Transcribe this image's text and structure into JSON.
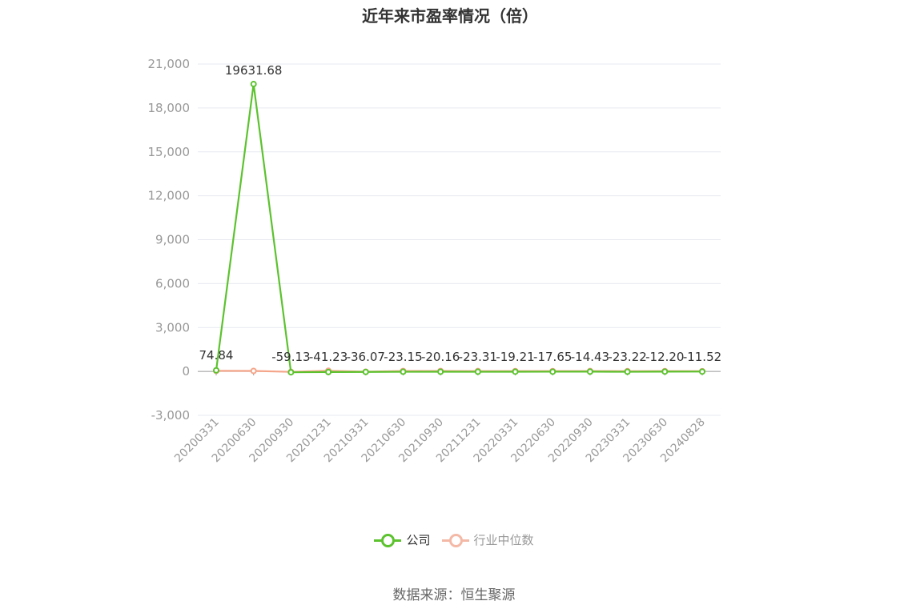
{
  "chart_data": {
    "type": "line",
    "title": "近年来市盈率情况（倍）",
    "categories": [
      "20200331",
      "20200630",
      "20200930",
      "20201231",
      "20210331",
      "20210630",
      "20210930",
      "20211231",
      "20220331",
      "20220630",
      "20220930",
      "20230331",
      "20230630",
      "20240828"
    ],
    "series": [
      {
        "name": "公司",
        "color": "#5cc22e",
        "values": [
          74.84,
          19631.68,
          -59.13,
          -41.23,
          -36.07,
          -23.15,
          -20.16,
          -23.31,
          -19.21,
          -17.65,
          -14.43,
          -23.22,
          -12.2,
          -11.52
        ],
        "labels": [
          "74.84",
          "19631.68",
          "-59.13",
          "-41.23",
          "-36.07",
          "-23.15",
          "-20.16",
          "-23.31",
          "-19.21",
          "-17.65",
          "-14.43",
          "-23.22",
          "-12.20",
          "-11.52"
        ]
      },
      {
        "name": "行业中位数",
        "color": "#f4a58a",
        "values": [
          40,
          35,
          -30,
          45,
          -20,
          30,
          28,
          25,
          20,
          22,
          24,
          18,
          20,
          15
        ]
      }
    ],
    "y_ticks": [
      "21,000",
      "18,000",
      "15,000",
      "12,000",
      "9,000",
      "6,000",
      "3,000",
      "0",
      "-3,000"
    ],
    "ylim": [
      -3000,
      21000
    ],
    "grid": true,
    "legend_position": "bottom-center"
  },
  "legend": {
    "company_label": "公司",
    "industry_label": "行业中位数"
  },
  "source": "数据来源：恒生聚源"
}
